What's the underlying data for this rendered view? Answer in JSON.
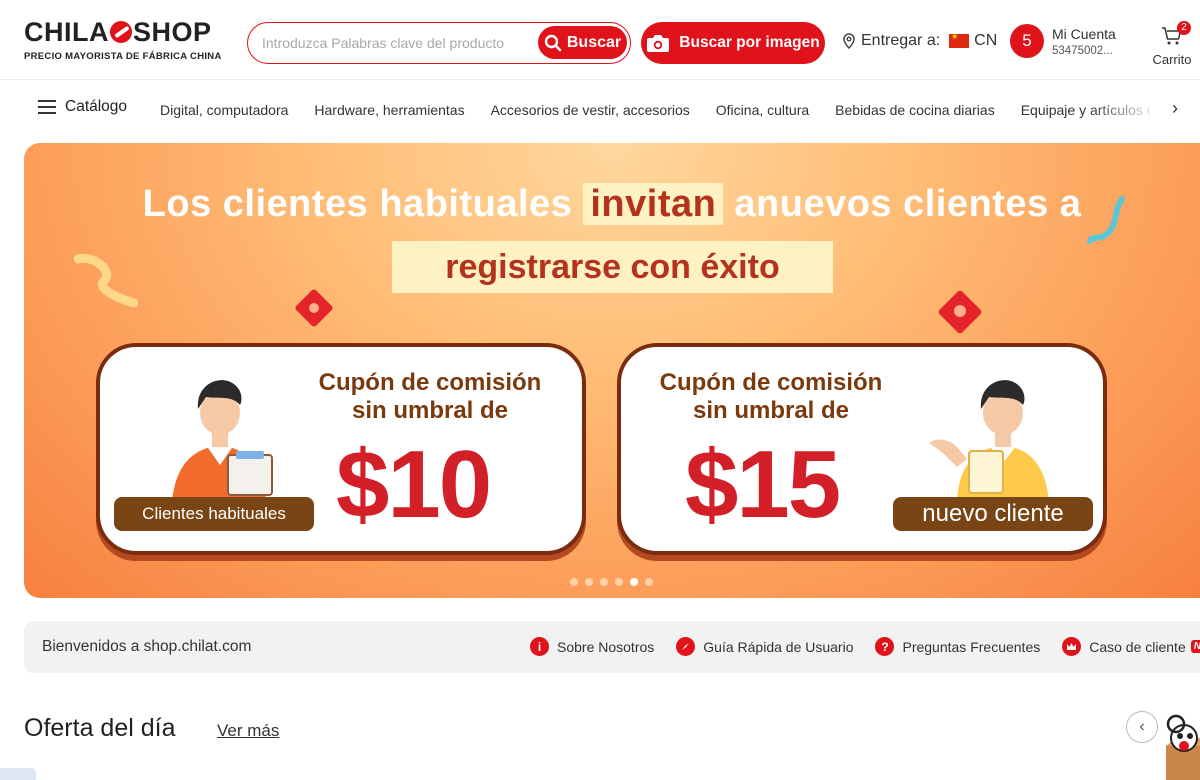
{
  "header": {
    "logo_main": "CHILAT SHOP",
    "logo_sub": "PRECIO MAYORISTA DE FÁBRICA CHINA",
    "search_placeholder": "Introduzca Palabras clave del producto",
    "search_button": "Buscar",
    "image_search_button": "Buscar por imagen",
    "deliver_label": "Entregar a:",
    "deliver_country": "CN",
    "account_initial": "5",
    "account_title": "Mi Cuenta",
    "account_id": "53475002...",
    "cart_count": "2",
    "cart_label": "Carrito"
  },
  "nav": {
    "catalog_label": "Catálogo",
    "categories": [
      "Digital, computadora",
      "Hardware, herramientas",
      "Accesorios de vestir, accesorios",
      "Oficina, cultura",
      "Bebidas de cocina diarias",
      "Equipaje y artículos de cuero"
    ]
  },
  "banner": {
    "line1_pre": "Los clientes habituales",
    "line1_highlight": "invitan",
    "line1_post": "anuevos clientes a",
    "line2": "registrarse con éxito",
    "card_left": {
      "title_line1": "Cupón de comisión",
      "title_line2": "sin umbral de",
      "amount": "$10",
      "tag": "Clientes habituales"
    },
    "card_right": {
      "title_line1": "Cupón de comisión",
      "title_line2": "sin umbral de",
      "amount": "$15",
      "tag": "nuevo cliente"
    },
    "slide_count": 6,
    "active_slide": 5
  },
  "welcome": {
    "text": "Bienvenidos a shop.chilat.com",
    "links": [
      {
        "label": "Sobre Nosotros",
        "icon": "info-icon"
      },
      {
        "label": "Guía Rápida de Usuario",
        "icon": "compass-icon"
      },
      {
        "label": "Preguntas Frecuentes",
        "icon": "question-icon"
      },
      {
        "label": "Caso de cliente",
        "icon": "crown-icon",
        "badge": "New!"
      }
    ]
  },
  "deals": {
    "title": "Oferta del día",
    "more_label": "Ver más"
  },
  "colors": {
    "brand_red": "#e0121a",
    "banner_orange": "#fb9955",
    "amount_red": "#d32028",
    "tag_brown": "#7a4515"
  }
}
